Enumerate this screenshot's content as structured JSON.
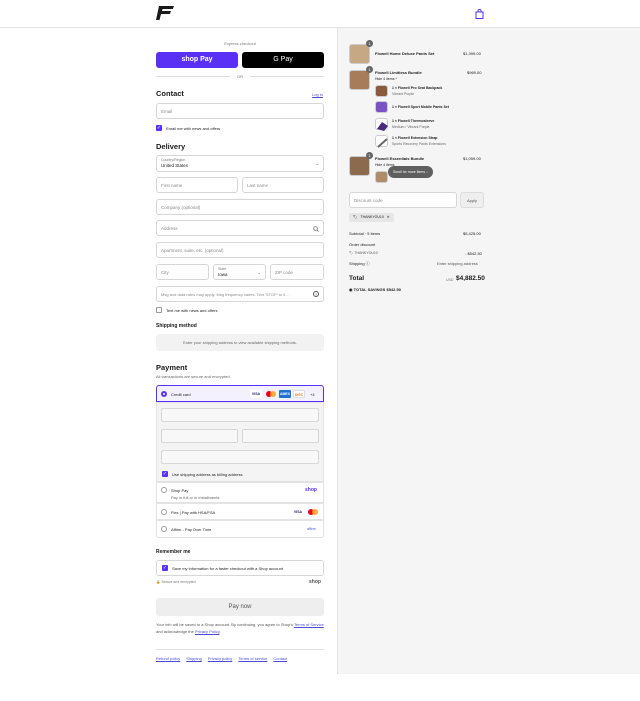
{
  "express": {
    "label": "Express checkout",
    "or": "OR",
    "shop_pay": "shop Pay",
    "gpay": "G Pay"
  },
  "contact": {
    "title": "Contact",
    "login": "Log in",
    "email_placeholder": "Email",
    "news_label": "Email me with news and offers"
  },
  "delivery": {
    "title": "Delivery",
    "country_label": "Country/Region",
    "country_value": "United States",
    "first_name": "First name",
    "last_name": "Last name",
    "company": "Company (optional)",
    "address": "Address",
    "apartment": "Apartment, suite, etc. (optional)",
    "city": "City",
    "state_label": "State",
    "state_value": "Iowa",
    "zip": "ZIP code",
    "sms_placeholder": "Msg and data rates may apply. Msg frequency varies. Text 'STOP' to 0...",
    "sms_label": "Text me with news and offers"
  },
  "shipping_method": {
    "title": "Shipping method",
    "placeholder": "Enter your shipping address to view available shipping methods."
  },
  "payment": {
    "title": "Payment",
    "subtitle": "All transactions are secure and encrypted.",
    "credit_card": "Credit card",
    "more_cards": "+4",
    "billing_label": "Use shipping address as billing address",
    "shop_pay": "Shop Pay",
    "shop_pay_sub": "Pay in full or in installments",
    "shop_logo": "shop",
    "flex": "Flex | Pay with HSA/FSA",
    "affirm": "Affirm - Pay Over Time",
    "affirm_logo": "affirm"
  },
  "remember": {
    "title": "Remember me",
    "label": "Save my information for a faster checkout with a Shop account",
    "secure": "Secure and encrypted",
    "shop": "shop"
  },
  "pay_button": "Pay now",
  "legal": {
    "pre": "Your info will be saved to a Shop account. By continuing, you agree to Shop's",
    "terms": "Terms of Service",
    "mid": "and acknowledge the",
    "privacy": "Privacy Policy",
    "end": "."
  },
  "footer": [
    "Refund policy",
    "Shipping",
    "Privacy policy",
    "Terms of service",
    "Contact"
  ],
  "cart": {
    "items": [
      {
        "qty": "1",
        "name": "Flowell Home Deluxe Pants Set",
        "price": "$1,399.00"
      },
      {
        "qty": "1",
        "name": "Flowell Limitless Bundle",
        "toggle": "Hide 4 items",
        "price": "$969.00",
        "sub": [
          {
            "name": "1 × Flowell Pro Seat Backpack",
            "variant": "Vibrant Purple"
          },
          {
            "name": "1 × Flowell Sport Mobile Pants Set",
            "variant": ""
          },
          {
            "name": "1 × Flowell Thermosleeve",
            "variant": "Medium / Vibrant Purple"
          },
          {
            "name": "1 × Flowell Extension Strap",
            "variant": "Sports Recovery Pants Extensions"
          }
        ]
      },
      {
        "qty": "1",
        "name": "Flowell Essentials Bundle",
        "toggle": "Hide 4 items",
        "price": "$1,059.00"
      }
    ],
    "scroll_hint": "Scroll for more items",
    "discount_placeholder": "Discount code",
    "apply": "Apply",
    "code": "THANKYOU10",
    "subtotal_label": "Subtotal · 5 items",
    "subtotal": "$5,425.00",
    "order_discount": "Order discount",
    "discount_code": "THANKYOU10",
    "discount_value": "- $542.50",
    "shipping_label": "Shipping",
    "shipping_value": "Enter shipping address",
    "total_label": "Total",
    "currency": "USD",
    "total": "$4,882.50",
    "savings_label": "TOTAL SAVINGS",
    "savings": "$542.50"
  },
  "colors": {
    "accent": "#5a31f4",
    "link": "#4a4ad6",
    "panel": "#f5f5f5"
  }
}
